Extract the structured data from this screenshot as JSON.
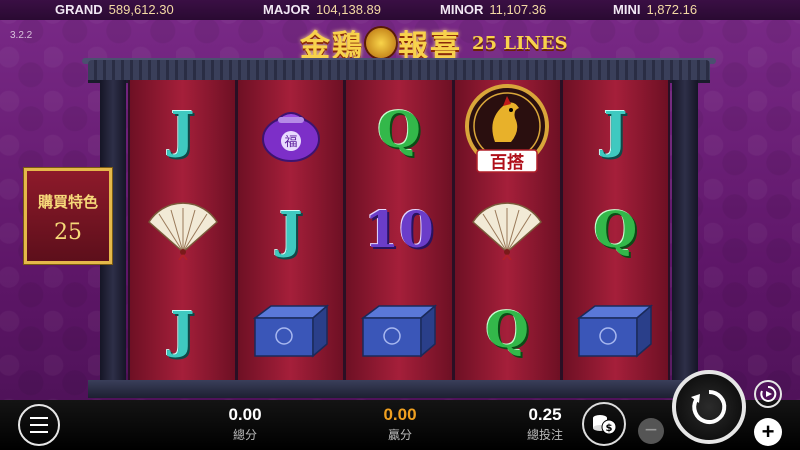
{
  "jackpots": [
    {
      "name": "GRAND",
      "value": "589,612.30"
    },
    {
      "name": "MAJOR",
      "value": "104,138.89"
    },
    {
      "name": "MINOR",
      "value": "11,107.36"
    },
    {
      "name": "MINI",
      "value": "1,872.16"
    }
  ],
  "version": "3.2.2",
  "title": {
    "left": "金鶏",
    "right": "報喜",
    "lines": "25 LINES"
  },
  "buy_feature": {
    "label": "購買特色",
    "value": "25"
  },
  "reels": [
    [
      "J",
      "fan",
      "J"
    ],
    [
      "purple-bag",
      "J",
      "blue-box"
    ],
    [
      "Q",
      "10",
      "blue-box"
    ],
    [
      "rooster-wild",
      "fan",
      "Q"
    ],
    [
      "J",
      "Q",
      "blue-box"
    ]
  ],
  "wild_text": "百搭",
  "bag_text": "福",
  "bottom": {
    "total_win": {
      "value": "0.00",
      "label": "總分"
    },
    "win": {
      "value": "0.00",
      "label": "贏分"
    },
    "total_bet": {
      "value": "0.25",
      "label": "總投注"
    }
  },
  "colors": {
    "accent": "#f8d24c",
    "win_value": "#f0a020",
    "reel_red": "#a51f3a"
  }
}
